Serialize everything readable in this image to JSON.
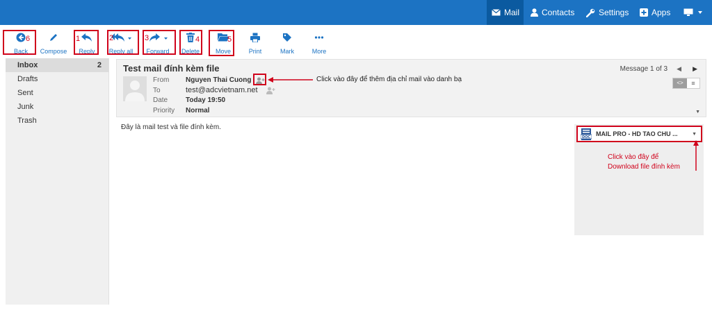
{
  "topnav": {
    "mail": "Mail",
    "contacts": "Contacts",
    "settings": "Settings",
    "apps": "Apps"
  },
  "toolbar": {
    "back": "Back",
    "compose": "Compose",
    "reply": "Reply",
    "reply_all": "Reply all",
    "forward": "Forward",
    "delete": "Delete",
    "move": "Move",
    "print": "Print",
    "mark": "Mark",
    "more": "More",
    "step_back": "6",
    "step_reply": "1",
    "step_reply_all": "2",
    "step_forward": "3",
    "step_delete": "4",
    "step_move": "5"
  },
  "folders": [
    {
      "label": "Inbox",
      "count": "2"
    },
    {
      "label": "Drafts",
      "count": ""
    },
    {
      "label": "Sent",
      "count": ""
    },
    {
      "label": "Junk",
      "count": ""
    },
    {
      "label": "Trash",
      "count": ""
    }
  ],
  "message": {
    "subject": "Test mail đính kèm file",
    "from_label": "From",
    "from_value": "Nguyen Thai Cuong",
    "to_label": "To",
    "to_value": "test@adcvietnam.net",
    "date_label": "Date",
    "date_value": "Today 19:50",
    "priority_label": "Priority",
    "priority_value": "Normal",
    "counter": "Message 1 of 3",
    "body": "Đây là mail test và file đính kèm."
  },
  "attachment": {
    "name": "MAIL PRO - HD TAO CHU ..."
  },
  "annotations": {
    "add_contact": "Click vào đây để thêm địa chỉ mail vào danh bạ",
    "download_line1": "Click vào đây để",
    "download_line2": "Download file đính kèm"
  },
  "colors": {
    "accent": "#1c73c3",
    "annotation": "#d0021b"
  }
}
